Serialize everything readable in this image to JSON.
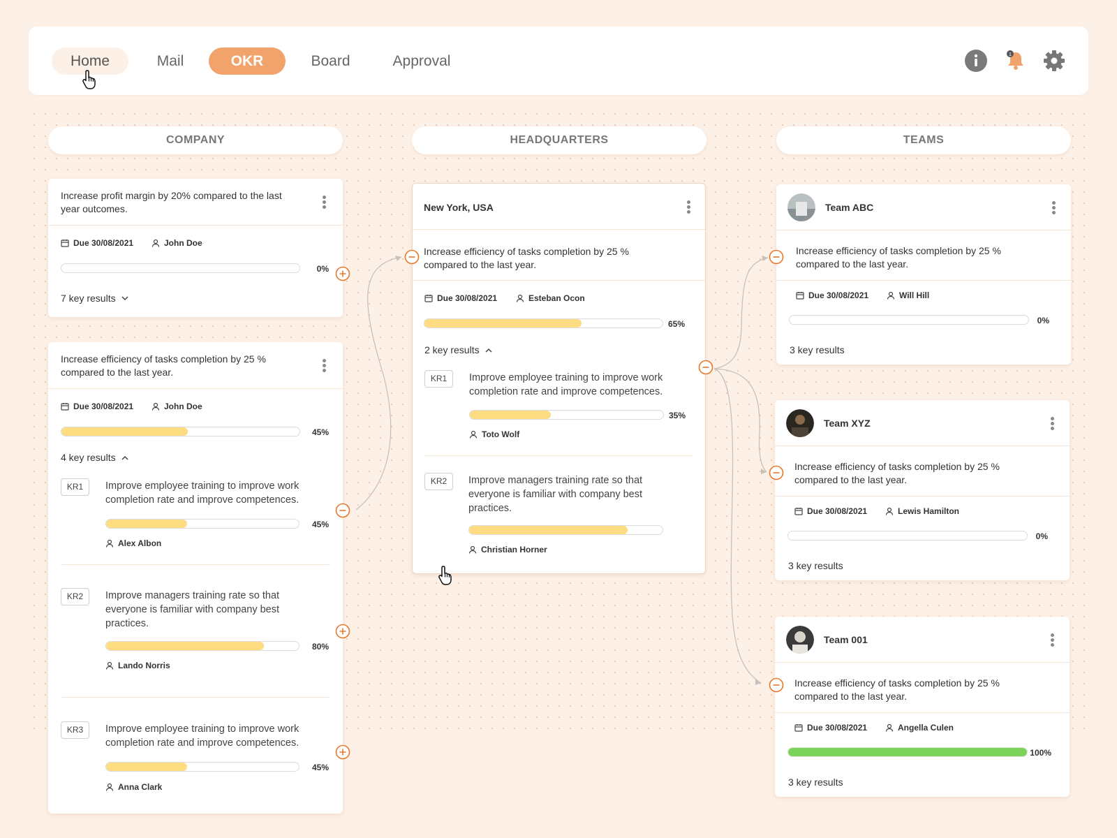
{
  "nav": {
    "tabs": [
      "Home",
      "Mail",
      "OKR",
      "Board",
      "Approval"
    ],
    "notification_count": "1",
    "icons": [
      "info-icon",
      "bell-icon",
      "gear-icon"
    ]
  },
  "colors": {
    "accent": "#f2a36b",
    "progress_yellow": "#fddc82",
    "progress_green": "#7dd35a",
    "node": "#e8782a"
  },
  "columns": [
    "COMPANY",
    "HEADQUARTERS",
    "TEAMS"
  ],
  "company": {
    "card1": {
      "objective": "Increase profit margin by 20% compared to the last year outcomes.",
      "due": "Due 30/08/2021",
      "owner": "John Doe",
      "progress": 0,
      "progress_label": "0%",
      "key_results_label": "7 key results"
    },
    "card2": {
      "objective": "Increase efficiency of tasks completion by 25 % compared to the last year.",
      "due": "Due 30/08/2021",
      "owner": "John Doe",
      "progress": 45,
      "progress_label": "45%",
      "key_results_label": "4 key results",
      "krs": [
        {
          "tag": "KR1",
          "text": "Improve employee training to improve work completion rate and improve competences.",
          "progress": 45,
          "progress_label": "45%",
          "owner": "Alex Albon"
        },
        {
          "tag": "KR2",
          "text": "Improve managers training rate so that everyone is familiar with company best practices.",
          "progress": 80,
          "progress_label": "80%",
          "owner": "Lando Norris"
        },
        {
          "tag": "KR3",
          "text": "Improve employee training to improve work completion rate and improve competences.",
          "progress": 45,
          "progress_label": "45%",
          "owner": "Anna Clark"
        }
      ]
    }
  },
  "hq": {
    "title": "New York, USA",
    "objective": "Increase efficiency of tasks completion by 25 % compared to the last year.",
    "due": "Due 30/08/2021",
    "owner": "Esteban Ocon",
    "progress": 65,
    "progress_label": "65%",
    "key_results_label": "2 key results",
    "krs": [
      {
        "tag": "KR1",
        "text": "Improve employee training to improve work completion rate and improve competences.",
        "progress": 35,
        "progress_label": "35%",
        "owner": "Toto Wolf"
      },
      {
        "tag": "KR2",
        "text": "Improve managers training rate so that everyone is familiar with company best practices.",
        "progress": 80,
        "owner": "Christian Horner"
      }
    ]
  },
  "teams": [
    {
      "name": "Team ABC",
      "objective": "Increase efficiency of tasks completion by 25 % compared to the last year.",
      "due": "Due 30/08/2021",
      "owner": "Will Hill",
      "progress": 0,
      "progress_label": "0%",
      "key_results_label": "3 key results"
    },
    {
      "name": "Team XYZ",
      "objective": "Increase efficiency of tasks completion by 25 % compared to the last year.",
      "due": "Due 30/08/2021",
      "owner": "Lewis Hamilton",
      "progress": 0,
      "progress_label": "0%",
      "key_results_label": "3 key results"
    },
    {
      "name": "Team 001",
      "objective": "Increase efficiency of tasks completion by 25 % compared to the last year.",
      "due": "Due 30/08/2021",
      "owner": "Angella Culen",
      "progress": 100,
      "progress_label": "100%",
      "key_results_label": "3 key results"
    }
  ]
}
